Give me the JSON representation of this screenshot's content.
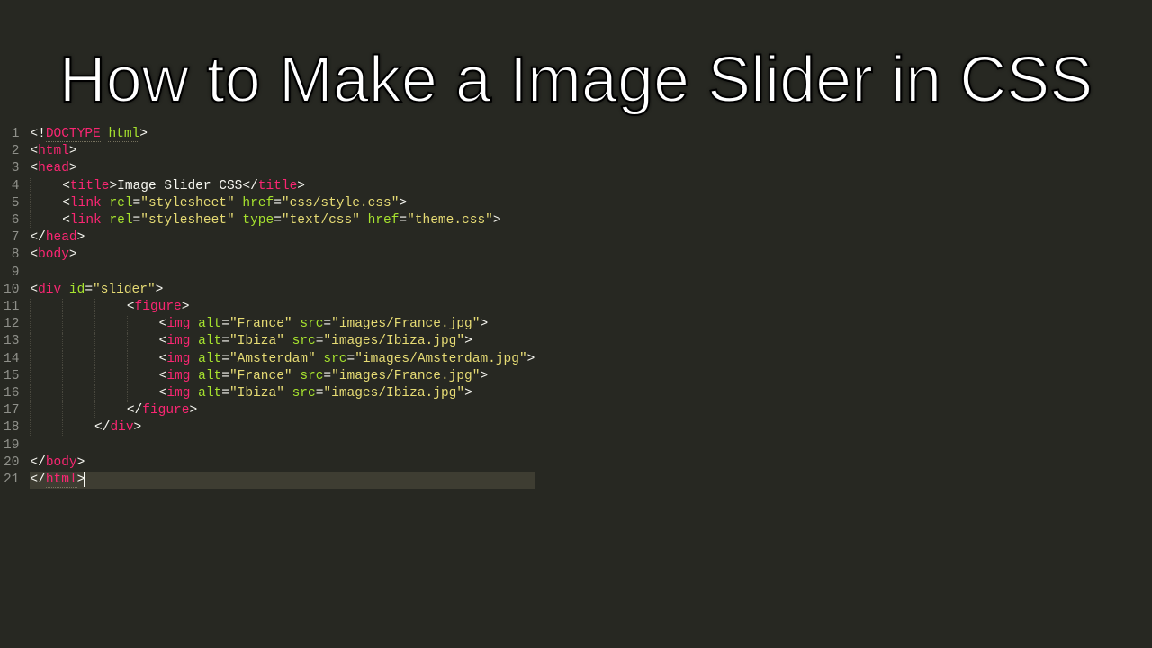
{
  "title_overlay": "How to Make a Image Slider in CSS",
  "line_numbers": [
    "1",
    "2",
    "3",
    "4",
    "5",
    "6",
    "7",
    "8",
    "9",
    "10",
    "11",
    "12",
    "13",
    "14",
    "15",
    "16",
    "17",
    "18",
    "19",
    "20",
    "21"
  ],
  "code": {
    "l1": {
      "tokens": [
        {
          "t": "<!",
          "k": "punct"
        },
        {
          "t": "DOCTYPE",
          "k": "tag",
          "u": true
        },
        {
          "t": " ",
          "k": "punct"
        },
        {
          "t": "html",
          "k": "attr",
          "u": true
        },
        {
          "t": ">",
          "k": "punct"
        }
      ],
      "indent": 0
    },
    "l2": {
      "tokens": [
        {
          "t": "<",
          "k": "punct"
        },
        {
          "t": "html",
          "k": "tag"
        },
        {
          "t": ">",
          "k": "punct"
        }
      ],
      "indent": 0
    },
    "l3": {
      "tokens": [
        {
          "t": "<",
          "k": "punct"
        },
        {
          "t": "head",
          "k": "tag"
        },
        {
          "t": ">",
          "k": "punct"
        }
      ],
      "indent": 0
    },
    "l4": {
      "tokens": [
        {
          "t": "<",
          "k": "punct"
        },
        {
          "t": "title",
          "k": "tag"
        },
        {
          "t": ">",
          "k": "punct"
        },
        {
          "t": "Image Slider CSS",
          "k": "text"
        },
        {
          "t": "</",
          "k": "punct"
        },
        {
          "t": "title",
          "k": "tag"
        },
        {
          "t": ">",
          "k": "punct"
        }
      ],
      "indent": 1
    },
    "l5": {
      "tokens": [
        {
          "t": "<",
          "k": "punct"
        },
        {
          "t": "link",
          "k": "tag"
        },
        {
          "t": " ",
          "k": "punct"
        },
        {
          "t": "rel",
          "k": "attr"
        },
        {
          "t": "=",
          "k": "punct"
        },
        {
          "t": "\"stylesheet\"",
          "k": "str"
        },
        {
          "t": " ",
          "k": "punct"
        },
        {
          "t": "href",
          "k": "attr"
        },
        {
          "t": "=",
          "k": "punct"
        },
        {
          "t": "\"css/style.css\"",
          "k": "str"
        },
        {
          "t": ">",
          "k": "punct"
        }
      ],
      "indent": 1
    },
    "l6": {
      "tokens": [
        {
          "t": "<",
          "k": "punct"
        },
        {
          "t": "link",
          "k": "tag"
        },
        {
          "t": " ",
          "k": "punct"
        },
        {
          "t": "rel",
          "k": "attr"
        },
        {
          "t": "=",
          "k": "punct"
        },
        {
          "t": "\"stylesheet\"",
          "k": "str"
        },
        {
          "t": " ",
          "k": "punct"
        },
        {
          "t": "type",
          "k": "attr"
        },
        {
          "t": "=",
          "k": "punct"
        },
        {
          "t": "\"text/css\"",
          "k": "str"
        },
        {
          "t": " ",
          "k": "punct"
        },
        {
          "t": "href",
          "k": "attr"
        },
        {
          "t": "=",
          "k": "punct"
        },
        {
          "t": "\"theme.css\"",
          "k": "str"
        },
        {
          "t": ">",
          "k": "punct"
        }
      ],
      "indent": 1
    },
    "l7": {
      "tokens": [
        {
          "t": "</",
          "k": "punct"
        },
        {
          "t": "head",
          "k": "tag"
        },
        {
          "t": ">",
          "k": "punct"
        }
      ],
      "indent": 0
    },
    "l8": {
      "tokens": [
        {
          "t": "<",
          "k": "punct"
        },
        {
          "t": "body",
          "k": "tag"
        },
        {
          "t": ">",
          "k": "punct"
        }
      ],
      "indent": 0
    },
    "l9": {
      "tokens": [],
      "indent": 0
    },
    "l10": {
      "tokens": [
        {
          "t": "<",
          "k": "punct"
        },
        {
          "t": "div",
          "k": "tag"
        },
        {
          "t": " ",
          "k": "punct"
        },
        {
          "t": "id",
          "k": "attr"
        },
        {
          "t": "=",
          "k": "punct"
        },
        {
          "t": "\"slider\"",
          "k": "str"
        },
        {
          "t": ">",
          "k": "punct"
        }
      ],
      "indent": 0
    },
    "l11": {
      "tokens": [
        {
          "t": "<",
          "k": "punct"
        },
        {
          "t": "figure",
          "k": "tag"
        },
        {
          "t": ">",
          "k": "punct"
        }
      ],
      "indent": 3
    },
    "l12": {
      "tokens": [
        {
          "t": "<",
          "k": "punct"
        },
        {
          "t": "img",
          "k": "tag"
        },
        {
          "t": " ",
          "k": "punct"
        },
        {
          "t": "alt",
          "k": "attr"
        },
        {
          "t": "=",
          "k": "punct"
        },
        {
          "t": "\"France\"",
          "k": "str"
        },
        {
          "t": " ",
          "k": "punct"
        },
        {
          "t": "src",
          "k": "attr"
        },
        {
          "t": "=",
          "k": "punct"
        },
        {
          "t": "\"images/France.jpg\"",
          "k": "str"
        },
        {
          "t": ">",
          "k": "punct"
        }
      ],
      "indent": 4
    },
    "l13": {
      "tokens": [
        {
          "t": "<",
          "k": "punct"
        },
        {
          "t": "img",
          "k": "tag"
        },
        {
          "t": " ",
          "k": "punct"
        },
        {
          "t": "alt",
          "k": "attr"
        },
        {
          "t": "=",
          "k": "punct"
        },
        {
          "t": "\"Ibiza\"",
          "k": "str"
        },
        {
          "t": " ",
          "k": "punct"
        },
        {
          "t": "src",
          "k": "attr"
        },
        {
          "t": "=",
          "k": "punct"
        },
        {
          "t": "\"images/Ibiza.jpg\"",
          "k": "str"
        },
        {
          "t": ">",
          "k": "punct"
        }
      ],
      "indent": 4
    },
    "l14": {
      "tokens": [
        {
          "t": "<",
          "k": "punct"
        },
        {
          "t": "img",
          "k": "tag"
        },
        {
          "t": " ",
          "k": "punct"
        },
        {
          "t": "alt",
          "k": "attr"
        },
        {
          "t": "=",
          "k": "punct"
        },
        {
          "t": "\"Amsterdam\"",
          "k": "str"
        },
        {
          "t": " ",
          "k": "punct"
        },
        {
          "t": "src",
          "k": "attr"
        },
        {
          "t": "=",
          "k": "punct"
        },
        {
          "t": "\"images/Amsterdam.jpg\"",
          "k": "str"
        },
        {
          "t": ">",
          "k": "punct"
        }
      ],
      "indent": 4
    },
    "l15": {
      "tokens": [
        {
          "t": "<",
          "k": "punct"
        },
        {
          "t": "img",
          "k": "tag"
        },
        {
          "t": " ",
          "k": "punct"
        },
        {
          "t": "alt",
          "k": "attr"
        },
        {
          "t": "=",
          "k": "punct"
        },
        {
          "t": "\"France\"",
          "k": "str"
        },
        {
          "t": " ",
          "k": "punct"
        },
        {
          "t": "src",
          "k": "attr"
        },
        {
          "t": "=",
          "k": "punct"
        },
        {
          "t": "\"images/France.jpg\"",
          "k": "str"
        },
        {
          "t": ">",
          "k": "punct"
        }
      ],
      "indent": 4
    },
    "l16": {
      "tokens": [
        {
          "t": "<",
          "k": "punct"
        },
        {
          "t": "img",
          "k": "tag"
        },
        {
          "t": " ",
          "k": "punct"
        },
        {
          "t": "alt",
          "k": "attr"
        },
        {
          "t": "=",
          "k": "punct"
        },
        {
          "t": "\"Ibiza\"",
          "k": "str"
        },
        {
          "t": " ",
          "k": "punct"
        },
        {
          "t": "src",
          "k": "attr"
        },
        {
          "t": "=",
          "k": "punct"
        },
        {
          "t": "\"images/Ibiza.jpg\"",
          "k": "str"
        },
        {
          "t": ">",
          "k": "punct"
        }
      ],
      "indent": 4
    },
    "l17": {
      "tokens": [
        {
          "t": "</",
          "k": "punct"
        },
        {
          "t": "figure",
          "k": "tag"
        },
        {
          "t": ">",
          "k": "punct"
        }
      ],
      "indent": 3
    },
    "l18": {
      "tokens": [
        {
          "t": "</",
          "k": "punct"
        },
        {
          "t": "div",
          "k": "tag"
        },
        {
          "t": ">",
          "k": "punct"
        }
      ],
      "indent": 2
    },
    "l19": {
      "tokens": [],
      "indent": 0
    },
    "l20": {
      "tokens": [
        {
          "t": "</",
          "k": "punct"
        },
        {
          "t": "body",
          "k": "tag"
        },
        {
          "t": ">",
          "k": "punct"
        }
      ],
      "indent": 0
    },
    "l21": {
      "tokens": [
        {
          "t": "</",
          "k": "punct"
        },
        {
          "t": "html",
          "k": "tag",
          "u": true
        },
        {
          "t": ">",
          "k": "punct"
        }
      ],
      "indent": 0,
      "active": true,
      "cursor": true
    }
  }
}
